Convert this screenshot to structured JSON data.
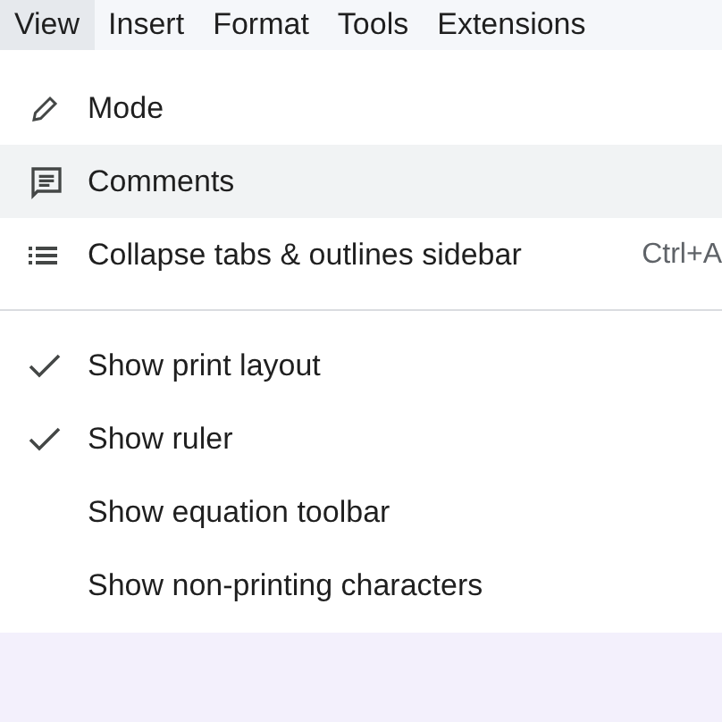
{
  "menu_bar": [
    {
      "label": "View",
      "selected": true
    },
    {
      "label": "Insert",
      "selected": false
    },
    {
      "label": "Format",
      "selected": false
    },
    {
      "label": "Tools",
      "selected": false
    },
    {
      "label": "Extensions",
      "selected": false
    }
  ],
  "menu": {
    "sections": [
      {
        "items": [
          {
            "kind": "action",
            "label": "Mode",
            "highlighted": false
          },
          {
            "kind": "action",
            "label": "Comments",
            "highlighted": true
          },
          {
            "kind": "action",
            "label": "Collapse tabs & outlines sidebar",
            "shortcut": "Ctrl+A",
            "highlighted": false
          }
        ]
      },
      {
        "items": [
          {
            "kind": "toggle",
            "label": "Show print layout",
            "checked": true,
            "highlighted": false
          },
          {
            "kind": "toggle",
            "label": "Show ruler",
            "checked": true,
            "highlighted": false
          },
          {
            "kind": "toggle",
            "label": "Show equation toolbar",
            "checked": false,
            "highlighted": false
          },
          {
            "kind": "toggle",
            "label": "Show non-printing characters",
            "checked": false,
            "highlighted": false
          }
        ]
      }
    ]
  }
}
